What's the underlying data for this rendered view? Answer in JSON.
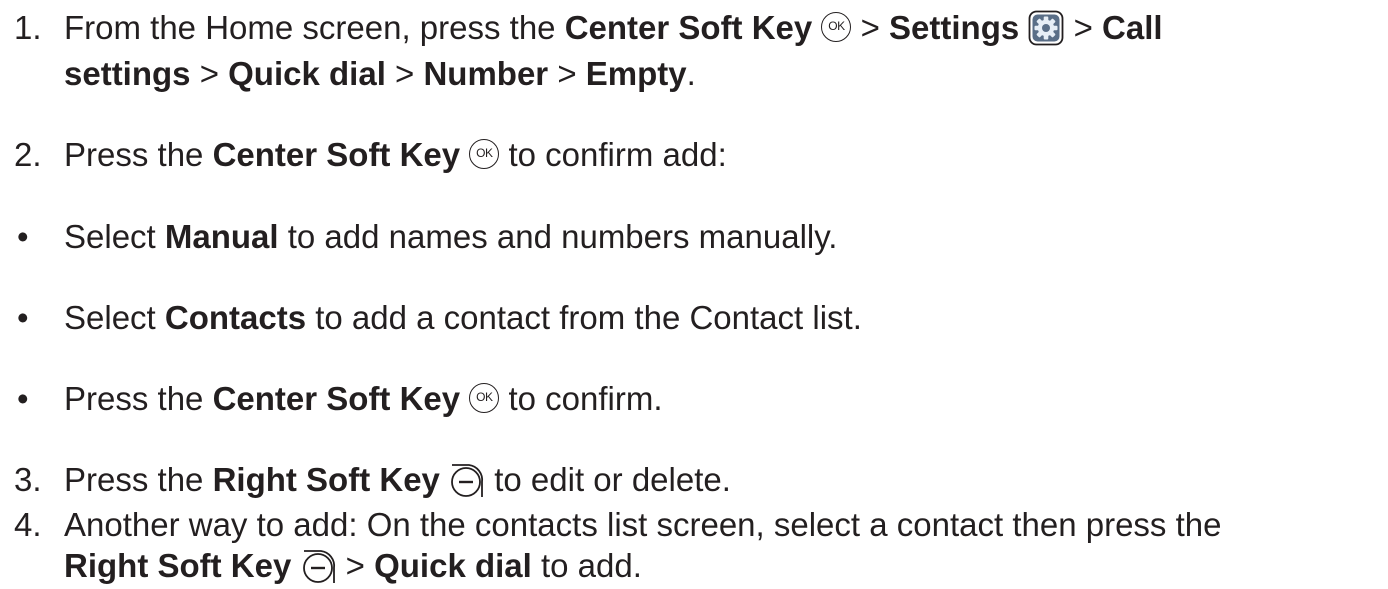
{
  "steps": [
    {
      "num": "1.",
      "l1_a": "From the Home screen, press the ",
      "l1_b": "Center Soft Key",
      "l1_c": " > ",
      "l1_d": "Settings",
      "l1_e": " > ",
      "l1_f": "Call",
      "l2_a": "settings",
      "l2_b": " > ",
      "l2_c": "Quick dial",
      "l2_d": " > ",
      "l2_e": "Number",
      "l2_f": " > ",
      "l2_g": "Empty",
      "l2_h": "."
    },
    {
      "num": "2.",
      "a": "Press the ",
      "b": "Center Soft Key",
      "c": " to confirm add:"
    },
    {
      "num": "3.",
      "a": "Press the ",
      "b": "Right Soft Key",
      "c": " to edit or delete."
    },
    {
      "num": "4.",
      "l1": "Another way to add: On the contacts list screen, select a contact then press the",
      "l2_a": "Right Soft Key",
      "l2_b": " > ",
      "l2_c": "Quick dial",
      "l2_d": " to add."
    }
  ],
  "bullets": [
    {
      "marker": "•",
      "a": "Select ",
      "b": "Manual",
      "c": " to add names and numbers manually."
    },
    {
      "marker": "•",
      "a": "Select ",
      "b": "Contacts",
      "c": " to add a contact from the Contact list."
    },
    {
      "marker": "•",
      "a": "Press the ",
      "b": "Center Soft Key",
      "c": " to confirm."
    }
  ],
  "icons": {
    "ok_label": "OK",
    "ok_icon": "ok-key-icon",
    "settings_icon": "settings-gear-icon",
    "right_soft_key_icon": "right-soft-key-icon"
  }
}
